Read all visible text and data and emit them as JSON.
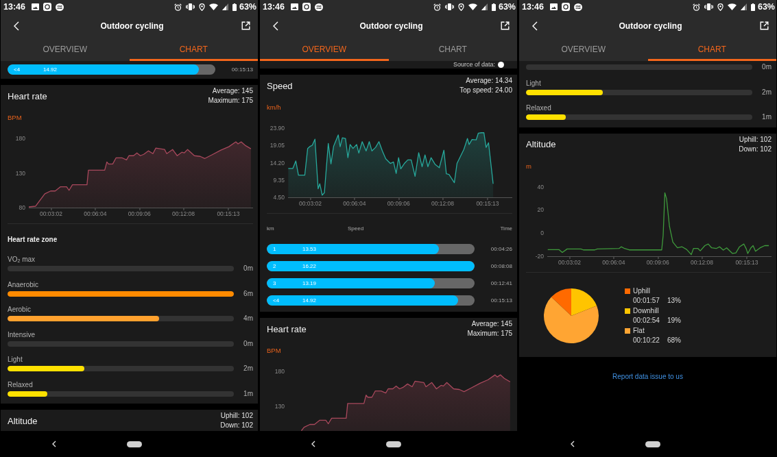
{
  "screens": [
    {
      "status_bar": {
        "time": "13:46",
        "battery": "63%"
      },
      "title": "Outdoor cycling",
      "tabs": [
        {
          "label": "OVERVIEW",
          "selected": false
        },
        {
          "label": "CHART",
          "selected": true
        }
      ],
      "cards": [
        {
          "splits": {
            "rows": [
              {
                "km": "<4",
                "speed": "14.92",
                "level": 0.92,
                "time": "00:15:13"
              }
            ]
          }
        },
        {
          "title": "Heart rate",
          "stats": [
            "Average: 145",
            "Maximum: 175"
          ],
          "chart_data": {
            "type": "area",
            "ylabel": "BPM",
            "x": [
              90,
              118,
              137,
              156,
              180,
              199,
              220,
              246,
              256,
              270,
              330,
              336,
              403,
              412,
              419,
              436,
              450,
              474,
              493,
              503,
              522,
              536,
              550,
              564,
              583,
              602,
              614,
              650,
              659,
              683,
              702,
              721,
              731,
              745,
              773,
              797,
              816,
              844,
              882,
              915,
              944,
              953,
              966,
              982,
              1006
            ],
            "series": [
              {
                "color": "#a8485c",
                "values": [
                  81,
                  82,
                  91,
                  100,
                  104,
                  104,
                  110,
                  110,
                  105,
                  113,
                  113,
                  134,
                  134,
                  146,
                  143,
                  143,
                  152,
                  152,
                  149,
                  155,
                  155,
                  159,
                  155,
                  157,
                  162,
                  158,
                  166,
                  164,
                  158,
                  164,
                  155,
                  160,
                  159,
                  164,
                  155,
                  154,
                  151,
                  156,
                  163,
                  168,
                  175,
                  172,
                  175,
                  170,
                  165
                ]
              }
            ],
            "xlim": [
              90,
              1015
            ],
            "ylim": [
              80,
              180
            ],
            "xticks": [
              {
                "value": 182,
                "label": "00:03:02"
              },
              {
                "value": 364,
                "label": "00:06:04"
              },
              {
                "value": 546,
                "label": "00:09:06"
              },
              {
                "value": 728,
                "label": "00:12:08"
              },
              {
                "value": 913,
                "label": "00:15:13"
              }
            ],
            "yticks": [
              80,
              130,
              180
            ]
          },
          "zones": {
            "title": "Heart rate zone",
            "items": [
              {
                "label": "VO$_{2}$ max",
                "level": 0,
                "value": "0m"
              },
              {
                "label": "Anaerobic",
                "level": 1,
                "color": "#ff8a00",
                "value": "6m"
              },
              {
                "label": "Aerobic",
                "level": 0.67,
                "color": "#ffa12e",
                "value": "4m"
              },
              {
                "label": "Intensive",
                "level": 0,
                "value": "0m"
              },
              {
                "label": "Light",
                "level": 0.34,
                "color": "#ffe100",
                "value": "2m"
              },
              {
                "label": "Relaxed",
                "level": 0.175,
                "color": "#ffe100",
                "value": "1m"
              }
            ]
          }
        },
        {
          "title": "Altitude",
          "stats": [
            "Uphill: 102",
            "Down: 102"
          ]
        }
      ]
    },
    {
      "status_bar": {
        "time": "13:46",
        "battery": "63%"
      },
      "title": "Outdoor cycling",
      "tabs": [
        {
          "label": "OVERVIEW",
          "selected": true
        },
        {
          "label": "CHART",
          "selected": false
        }
      ],
      "cards": [
        {
          "note": "Source of data:"
        },
        {
          "title": "Speed",
          "stats": [
            "Average: 14.34",
            "Top speed: 24.00"
          ],
          "chart_data": {
            "type": "area",
            "ylabel": "km/h",
            "x": [
              91,
              110,
              122,
              133,
              159,
              171,
              181,
              190,
              201,
              214,
              221,
              231,
              240,
              256,
              267,
              278,
              297,
              305,
              314,
              327,
              337,
              346,
              358,
              373,
              382,
              396,
              412,
              425,
              436,
              451,
              465,
              479,
              493,
              512,
              525,
              536,
              546,
              555,
              570,
              584,
              598,
              614,
              629,
              643,
              655,
              667,
              680,
              697,
              714,
              733,
              743,
              754,
              776,
              787,
              815,
              830,
              837,
              849,
              866,
              875,
              887,
              898,
              907,
              917,
              936
            ],
            "series": [
              {
                "color": "#27a99c",
                "values": [
                  12.6,
                  12.6,
                  14.7,
                  10.7,
                  10.7,
                  18.2,
                  18.8,
                  19.1,
                  20.8,
                  6.9,
                  8.3,
                  5.1,
                  5.8,
                  19.6,
                  13.9,
                  18.8,
                  22.0,
                  18.7,
                  21.2,
                  21.0,
                  15.6,
                  19.3,
                  18.2,
                  19.3,
                  16.9,
                  20.1,
                  17.5,
                  20.1,
                  17.5,
                  18.5,
                  20.1,
                  17.5,
                  15.3,
                  14.0,
                  14.4,
                  11.2,
                  15.6,
                  12.5,
                  14.0,
                  15.0,
                  15.0,
                  10.4,
                  17.0,
                  13.1,
                  16.4,
                  13.1,
                  15.6,
                  13.7,
                  12.8,
                  17.7,
                  11.1,
                  10.9,
                  8.6,
                  14.0,
                  17.9,
                  21.0,
                  19.3,
                  20.7,
                  20.6,
                  22.5,
                  22.6,
                  22.6,
                  18.5,
                  19.8,
                  8.3
                ]
              }
            ],
            "xlim": [
              90,
              1015
            ],
            "ylim": [
              4.5,
              23.9
            ],
            "xticks": [
              {
                "value": 182,
                "label": "00:03:02"
              },
              {
                "value": 364,
                "label": "00:06:04"
              },
              {
                "value": 546,
                "label": "00:09:06"
              },
              {
                "value": 728,
                "label": "00:12:08"
              },
              {
                "value": 913,
                "label": "00:15:13"
              }
            ],
            "yticks": [
              {
                "value": 4.5,
                "label": "4.50"
              },
              {
                "value": 9.35,
                "label": "9.35"
              },
              {
                "value": 14.2,
                "label": "14.20"
              },
              {
                "value": 19.05,
                "label": "19.05"
              },
              {
                "value": 23.9,
                "label": "23.90"
              }
            ]
          },
          "splits": {
            "columns": [
              "km",
              "Speed",
              "Time"
            ],
            "rows": [
              {
                "km": "1",
                "speed": "13.53",
                "level": 0.83,
                "time": "00:04:26"
              },
              {
                "km": "2",
                "speed": "16.22",
                "level": 1,
                "time": "00:08:08"
              },
              {
                "km": "3",
                "speed": "13.19",
                "level": 0.81,
                "time": "00:12:41"
              },
              {
                "km": "<4",
                "speed": "14.92",
                "level": 0.92,
                "time": "00:15:13"
              }
            ]
          }
        },
        {
          "title": "Heart rate",
          "stats": [
            "Average: 145",
            "Maximum: 175"
          ],
          "graph_picture": {
            "unit": "BPM",
            "scale": [
              "180",
              "130"
            ]
          }
        }
      ]
    },
    {
      "status_bar": {
        "time": "13:46",
        "battery": "63%"
      },
      "title": "Outdoor cycling",
      "tabs": [
        {
          "label": "OVERVIEW",
          "selected": false
        },
        {
          "label": "CHART",
          "selected": true
        }
      ],
      "cards": [
        {
          "zones": {
            "items": [
              {
                "level": 0,
                "value": "0m"
              },
              {
                "label": "Light",
                "level": 0.34,
                "color": "#ffe100",
                "value": "2m"
              },
              {
                "label": "Relaxed",
                "level": 0.177,
                "color": "#ffe100",
                "value": "1m"
              }
            ]
          }
        },
        {
          "title": "Altitude",
          "stats": [
            "Uphill: 102",
            "Down: 102"
          ],
          "chart_data": {
            "type": "line",
            "ylabel": "m",
            "x": [
              92,
              139,
              152,
              172,
              229,
              239,
              286,
              296,
              386,
              395,
              409,
              428,
              562,
              568,
              575,
              582,
              594,
              608,
              627,
              646,
              665,
              684,
              693,
              712,
              721,
              740,
              754,
              768,
              787,
              801,
              816,
              830,
              854,
              868,
              883,
              901,
              911,
              917,
              930,
              939,
              949,
              968,
              987,
              1004
            ],
            "series": [
              {
                "color": "#3f9a3c",
                "values": [
                  -14.3,
                  -14.3,
                  -16.7,
                  -13.7,
                  -13.7,
                  -14.5,
                  -14.5,
                  -13.7,
                  -13.3,
                  -11.8,
                  -13.3,
                  -14.5,
                  -14.5,
                  -2,
                  35,
                  30,
                  6,
                  -7.8,
                  -12.7,
                  -11.8,
                  -14.1,
                  -18.6,
                  -13.3,
                  -13.3,
                  -15.3,
                  -10.8,
                  -9.4,
                  -12.7,
                  -13.3,
                  -11.8,
                  -14.7,
                  -12.7,
                  -17.6,
                  -17.1,
                  -11.8,
                  -9.4,
                  -13.7,
                  -17.6,
                  -12.7,
                  -10.8,
                  -15.7,
                  -12.7,
                  -10.8,
                  -10.8
                ]
              }
            ],
            "xlim": [
              90,
              1015
            ],
            "ylim": [
              -20,
              40
            ],
            "xticks": [
              {
                "value": 182,
                "label": "00:03:02"
              },
              {
                "value": 364,
                "label": "00:06:04"
              },
              {
                "value": 546,
                "label": "00:09:06"
              },
              {
                "value": 728,
                "label": "00:12:08"
              },
              {
                "value": 913,
                "label": "00:15:13"
              }
            ],
            "yticks": [
              -20,
              0,
              20,
              40
            ]
          },
          "pie": {
            "chart_data": {
              "type": "pie",
              "categories": [
                "Uphill",
                "Downhill",
                "Flat"
              ],
              "values": [
                13,
                19,
                68
              ]
            },
            "legend": [
              {
                "color": "#ff6a00",
                "time": "00:01:57",
                "percent": "13%"
              },
              {
                "color": "#ffc400",
                "time": "00:02:54",
                "percent": "19%"
              },
              {
                "color": "#ffa533",
                "time": "00:10:22",
                "percent": "68%"
              }
            ]
          }
        }
      ],
      "footer_link": "Report data issue to us"
    }
  ]
}
